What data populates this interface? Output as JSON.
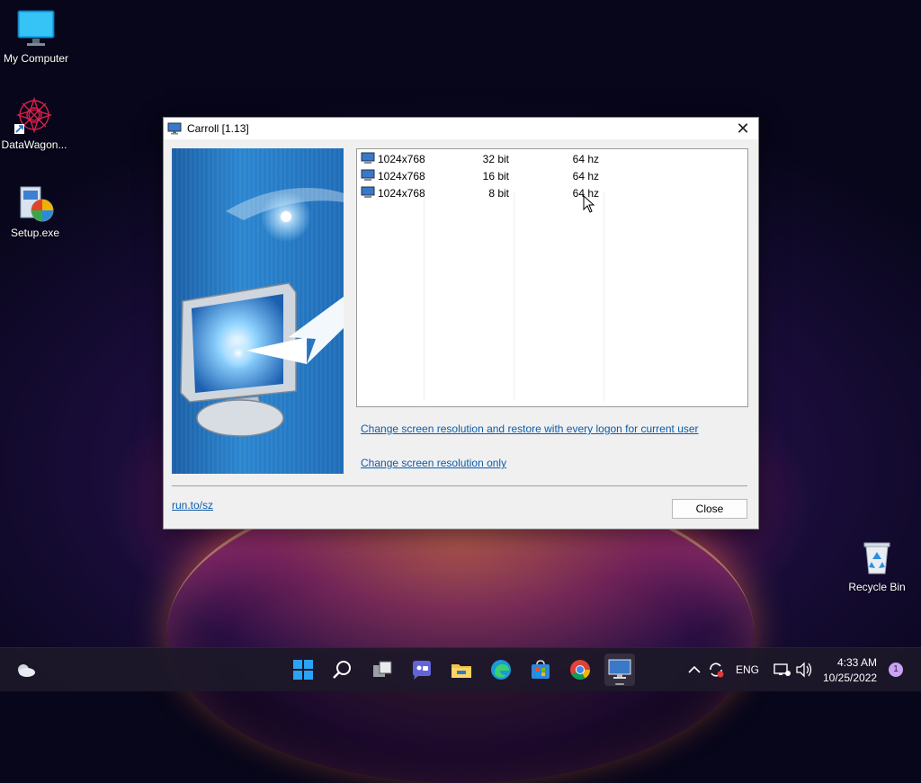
{
  "desktop": {
    "icons": [
      {
        "label": "My Computer"
      },
      {
        "label": "DataWagon..."
      },
      {
        "label": "Setup.exe"
      },
      {
        "label": "Recycle Bin"
      }
    ]
  },
  "window": {
    "title": "Carroll [1.13]",
    "modes": [
      {
        "resolution": "1024x768",
        "depth": "32 bit",
        "refresh": "64 hz"
      },
      {
        "resolution": "1024x768",
        "depth": "16 bit",
        "refresh": "64 hz"
      },
      {
        "resolution": "1024x768",
        "depth": "8 bit",
        "refresh": "64 hz"
      }
    ],
    "link_restore": "Change screen resolution and restore with every logon for current user",
    "link_only": "Change screen resolution only",
    "footer_link": "run.to/sz",
    "close_label": "Close"
  },
  "taskbar": {
    "tray": {
      "language": "ENG",
      "time": "4:33 AM",
      "date": "10/25/2022",
      "notification_count": "1"
    }
  },
  "colors": {
    "link": "#0b5cad",
    "taskbar": "#1c1828",
    "dialog_bg": "#f0f0f0"
  }
}
